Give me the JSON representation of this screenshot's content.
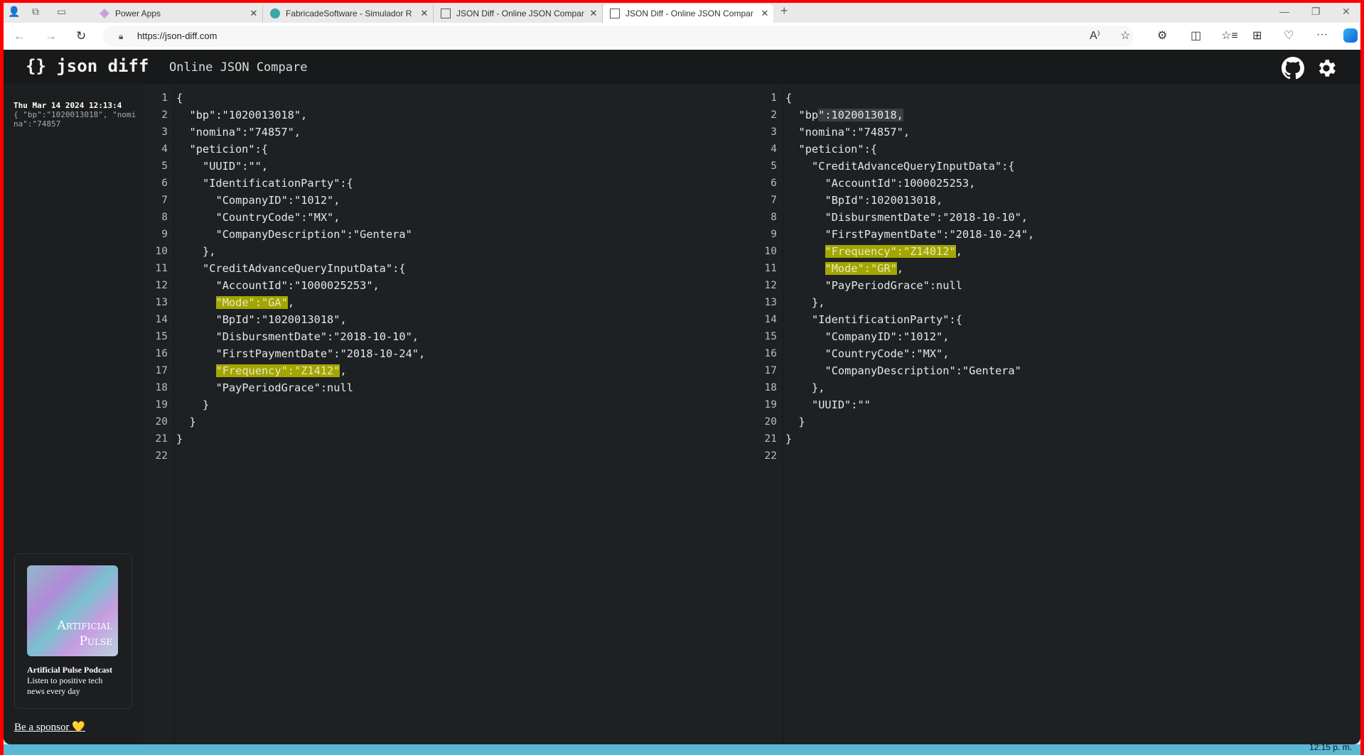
{
  "browser": {
    "tabs": [
      {
        "title": "Power Apps",
        "icon": "power-apps-icon",
        "active": false
      },
      {
        "title": "FabricadeSoftware - Simulador R",
        "icon": "sharepoint-icon",
        "active": false
      },
      {
        "title": "JSON Diff - Online JSON Compar",
        "icon": "page-icon",
        "active": false
      },
      {
        "title": "JSON Diff - Online JSON Compar",
        "icon": "page-icon",
        "active": true
      }
    ],
    "url": "https://json-diff.com"
  },
  "app": {
    "logo": "{} json diff",
    "subtitle": "Online JSON Compare"
  },
  "sidebar": {
    "history": [
      {
        "date": "Thu Mar 14 2024 12:13:4",
        "preview": "{ \"bp\":\"1020013018\", \"nomina\":\"74857"
      }
    ],
    "sponsor_card": {
      "image_text": "Artificial Pulse",
      "title": "Artificial Pulse Podcast",
      "description": "Listen to positive tech news every day"
    },
    "sponsor_link": "Be a sponsor 💛"
  },
  "colors": {
    "added_highlight": "#a3a600",
    "changed_highlight": "#3a3e42",
    "background": "#1e2124"
  },
  "left_editor": {
    "lines": [
      {
        "indent": 0,
        "segs": [
          {
            "t": "{"
          }
        ]
      },
      {
        "indent": 1,
        "segs": [
          {
            "t": "\"bp\":\"1020013018\","
          }
        ]
      },
      {
        "indent": 1,
        "segs": [
          {
            "t": "\"nomina\":\"74857\","
          }
        ]
      },
      {
        "indent": 1,
        "segs": [
          {
            "t": "\"peticion\":{"
          }
        ]
      },
      {
        "indent": 2,
        "segs": [
          {
            "t": "\"UUID\":\"\","
          }
        ]
      },
      {
        "indent": 2,
        "segs": [
          {
            "t": "\"IdentificationParty\":{"
          }
        ]
      },
      {
        "indent": 3,
        "segs": [
          {
            "t": "\"CompanyID\":\"1012\","
          }
        ]
      },
      {
        "indent": 3,
        "segs": [
          {
            "t": "\"CountryCode\":\"MX\","
          }
        ]
      },
      {
        "indent": 3,
        "segs": [
          {
            "t": "\"CompanyDescription\":\"Gentera\""
          }
        ]
      },
      {
        "indent": 2,
        "segs": [
          {
            "t": "},"
          }
        ]
      },
      {
        "indent": 2,
        "segs": [
          {
            "t": "\"CreditAdvanceQueryInputData\":{"
          }
        ]
      },
      {
        "indent": 3,
        "segs": [
          {
            "t": "\"AccountId\":\"1000025253\","
          }
        ]
      },
      {
        "indent": 3,
        "segs": [
          {
            "t": "\"Mode\":\"GA\"",
            "hl": "y"
          },
          {
            "t": ","
          }
        ]
      },
      {
        "indent": 3,
        "segs": [
          {
            "t": "\"BpId\":\"1020013018\","
          }
        ]
      },
      {
        "indent": 3,
        "segs": [
          {
            "t": "\"DisbursmentDate\":\"2018-10-10\","
          }
        ]
      },
      {
        "indent": 3,
        "segs": [
          {
            "t": "\"FirstPaymentDate\":\"2018-10-24\","
          }
        ]
      },
      {
        "indent": 3,
        "segs": [
          {
            "t": "\"Frequency\":\"Z1412\"",
            "hl": "y"
          },
          {
            "t": ","
          }
        ]
      },
      {
        "indent": 3,
        "segs": [
          {
            "t": "\"PayPeriodGrace\":null"
          }
        ]
      },
      {
        "indent": 2,
        "segs": [
          {
            "t": "}"
          }
        ]
      },
      {
        "indent": 1,
        "segs": [
          {
            "t": "}"
          }
        ]
      },
      {
        "indent": 0,
        "segs": [
          {
            "t": "}"
          }
        ]
      },
      {
        "indent": 0,
        "segs": [
          {
            "t": ""
          }
        ]
      }
    ]
  },
  "right_editor": {
    "lines": [
      {
        "indent": 0,
        "segs": [
          {
            "t": "{"
          }
        ]
      },
      {
        "indent": 1,
        "segs": [
          {
            "t": "\"bp"
          },
          {
            "t": "\":1020013018,",
            "hl": "g"
          }
        ]
      },
      {
        "indent": 1,
        "segs": [
          {
            "t": "\"nomina\":\"74857\","
          }
        ]
      },
      {
        "indent": 1,
        "segs": [
          {
            "t": "\"peticion\":{"
          }
        ]
      },
      {
        "indent": 2,
        "segs": [
          {
            "t": "\"CreditAdvanceQueryInputData\":{"
          }
        ]
      },
      {
        "indent": 3,
        "segs": [
          {
            "t": "\"AccountId\":1000025253,"
          }
        ]
      },
      {
        "indent": 3,
        "segs": [
          {
            "t": "\"BpId\":1020013018,"
          }
        ]
      },
      {
        "indent": 3,
        "segs": [
          {
            "t": "\"DisbursmentDate\":\"2018-10-10\","
          }
        ]
      },
      {
        "indent": 3,
        "segs": [
          {
            "t": "\"FirstPaymentDate\":\"2018-10-24\","
          }
        ]
      },
      {
        "indent": 3,
        "segs": [
          {
            "t": "\"Frequency\":\"Z14012\"",
            "hl": "y"
          },
          {
            "t": ","
          }
        ]
      },
      {
        "indent": 3,
        "segs": [
          {
            "t": "\"Mode\":\"GR\"",
            "hl": "y"
          },
          {
            "t": ","
          }
        ]
      },
      {
        "indent": 3,
        "segs": [
          {
            "t": "\"PayPeriodGrace\":null"
          }
        ]
      },
      {
        "indent": 2,
        "segs": [
          {
            "t": "},"
          }
        ]
      },
      {
        "indent": 2,
        "segs": [
          {
            "t": "\"IdentificationParty\":{"
          }
        ]
      },
      {
        "indent": 3,
        "segs": [
          {
            "t": "\"CompanyID\":\"1012\","
          }
        ]
      },
      {
        "indent": 3,
        "segs": [
          {
            "t": "\"CountryCode\":\"MX\","
          }
        ]
      },
      {
        "indent": 3,
        "segs": [
          {
            "t": "\"CompanyDescription\":\"Gentera\""
          }
        ]
      },
      {
        "indent": 2,
        "segs": [
          {
            "t": "},"
          }
        ]
      },
      {
        "indent": 2,
        "segs": [
          {
            "t": "\"UUID\":\"\""
          }
        ]
      },
      {
        "indent": 1,
        "segs": [
          {
            "t": "}"
          }
        ]
      },
      {
        "indent": 0,
        "segs": [
          {
            "t": "}"
          }
        ]
      },
      {
        "indent": 0,
        "segs": [
          {
            "t": ""
          }
        ]
      }
    ]
  },
  "taskbar": {
    "clock": "12:15 p. m."
  }
}
